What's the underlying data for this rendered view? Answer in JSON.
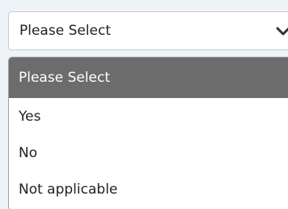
{
  "select": {
    "value": "Please Select",
    "icon": "chevron-down-icon"
  },
  "dropdown": {
    "options": [
      {
        "label": "Please Select",
        "selected": true
      },
      {
        "label": "Yes",
        "selected": false
      },
      {
        "label": "No",
        "selected": false
      },
      {
        "label": "Not applicable",
        "selected": false
      }
    ]
  },
  "colors": {
    "background": "#edf3f7",
    "highlight": "#6c6c6c",
    "highlight_text": "#ffffff"
  }
}
